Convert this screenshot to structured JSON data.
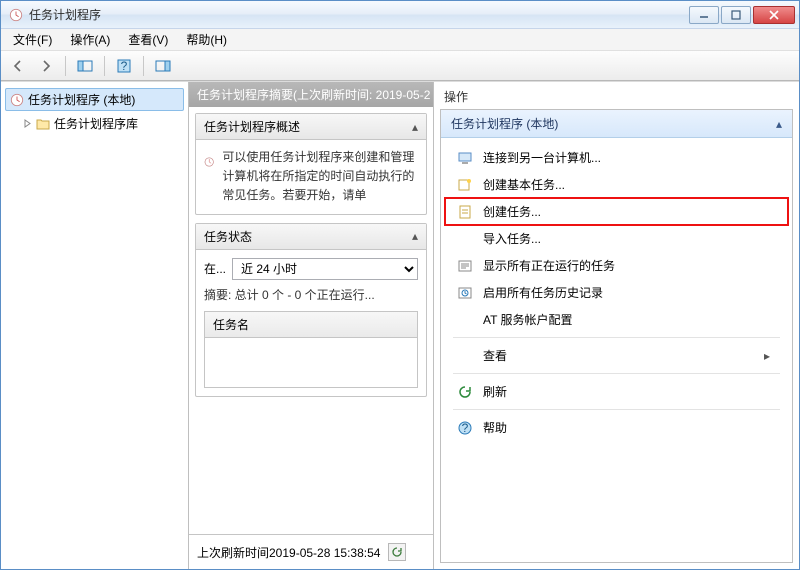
{
  "window": {
    "title": "任务计划程序"
  },
  "menu": {
    "file": "文件(F)",
    "action": "操作(A)",
    "view": "查看(V)",
    "help": "帮助(H)"
  },
  "tree": {
    "root": "任务计划程序 (本地)",
    "library": "任务计划程序库"
  },
  "middle": {
    "header": "任务计划程序摘要(上次刷新时间: 2019-05-2",
    "overview_title": "任务计划程序概述",
    "overview_text": "可以使用任务计划程序来创建和管理计算机将在所指定的时间自动执行的常见任务。若要开始，请单",
    "status_title": "任务状态",
    "status_in_label": "在...",
    "status_range": "近 24 小时",
    "summary": "摘要: 总计 0 个 - 0 个正在运行...",
    "taskname_col": "任务名",
    "last_refresh": "上次刷新时间2019-05-28 15:38:54"
  },
  "right": {
    "title": "操作",
    "group": "任务计划程序 (本地)",
    "actions": {
      "connect": "连接到另一台计算机...",
      "create_basic": "创建基本任务...",
      "create_task": "创建任务...",
      "import": "导入任务...",
      "show_running": "显示所有正在运行的任务",
      "enable_history": "启用所有任务历史记录",
      "at_service": "AT 服务帐户配置",
      "view": "查看",
      "refresh": "刷新",
      "help": "帮助"
    }
  }
}
